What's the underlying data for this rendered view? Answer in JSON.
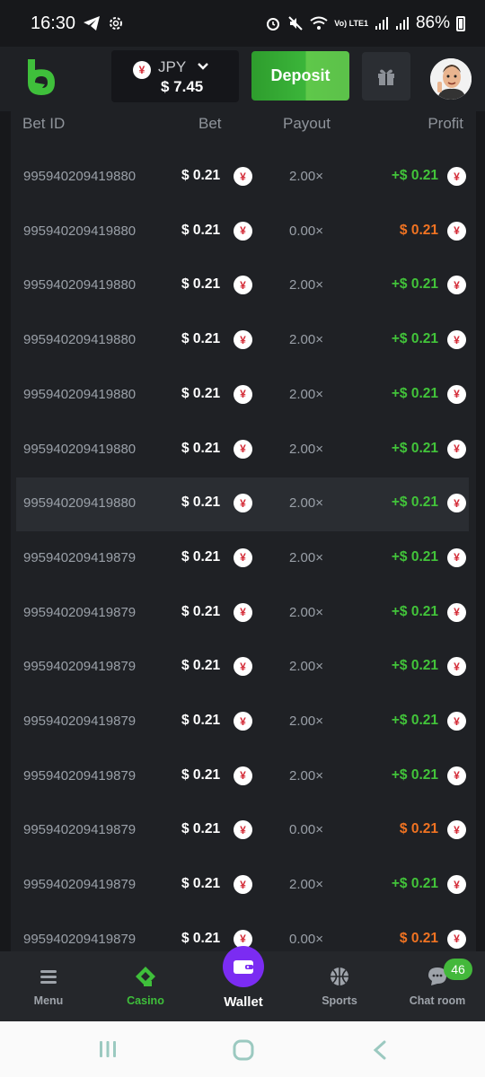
{
  "status_bar": {
    "time": "16:30",
    "network_label": "Vo) LTE1",
    "battery_percent": "86%"
  },
  "header": {
    "currency_symbol": "¥",
    "currency": "JPY",
    "balance": "$ 7.45",
    "deposit_label": "Deposit"
  },
  "table": {
    "columns": [
      "Bet ID",
      "Bet",
      "Payout",
      "Profit"
    ],
    "coin_symbol": "¥",
    "rows": [
      {
        "bet_id": "995940209419880",
        "bet": "$ 0.21",
        "payout": "2.00×",
        "profit": "+$ 0.21",
        "result": "win"
      },
      {
        "bet_id": "995940209419880",
        "bet": "$ 0.21",
        "payout": "0.00×",
        "profit": "$ 0.21",
        "result": "loss"
      },
      {
        "bet_id": "995940209419880",
        "bet": "$ 0.21",
        "payout": "2.00×",
        "profit": "+$ 0.21",
        "result": "win"
      },
      {
        "bet_id": "995940209419880",
        "bet": "$ 0.21",
        "payout": "2.00×",
        "profit": "+$ 0.21",
        "result": "win"
      },
      {
        "bet_id": "995940209419880",
        "bet": "$ 0.21",
        "payout": "2.00×",
        "profit": "+$ 0.21",
        "result": "win"
      },
      {
        "bet_id": "995940209419880",
        "bet": "$ 0.21",
        "payout": "2.00×",
        "profit": "+$ 0.21",
        "result": "win"
      },
      {
        "bet_id": "995940209419880",
        "bet": "$ 0.21",
        "payout": "2.00×",
        "profit": "+$ 0.21",
        "result": "win",
        "highlighted": true
      },
      {
        "bet_id": "995940209419879",
        "bet": "$ 0.21",
        "payout": "2.00×",
        "profit": "+$ 0.21",
        "result": "win"
      },
      {
        "bet_id": "995940209419879",
        "bet": "$ 0.21",
        "payout": "2.00×",
        "profit": "+$ 0.21",
        "result": "win"
      },
      {
        "bet_id": "995940209419879",
        "bet": "$ 0.21",
        "payout": "2.00×",
        "profit": "+$ 0.21",
        "result": "win"
      },
      {
        "bet_id": "995940209419879",
        "bet": "$ 0.21",
        "payout": "2.00×",
        "profit": "+$ 0.21",
        "result": "win"
      },
      {
        "bet_id": "995940209419879",
        "bet": "$ 0.21",
        "payout": "2.00×",
        "profit": "+$ 0.21",
        "result": "win"
      },
      {
        "bet_id": "995940209419879",
        "bet": "$ 0.21",
        "payout": "0.00×",
        "profit": "$ 0.21",
        "result": "loss"
      },
      {
        "bet_id": "995940209419879",
        "bet": "$ 0.21",
        "payout": "2.00×",
        "profit": "+$ 0.21",
        "result": "win"
      },
      {
        "bet_id": "995940209419879",
        "bet": "$ 0.21",
        "payout": "0.00×",
        "profit": "$ 0.21",
        "result": "loss"
      }
    ]
  },
  "bottom_nav": {
    "menu": "Menu",
    "casino": "Casino",
    "wallet": "Wallet",
    "sports": "Sports",
    "chat": "Chat room",
    "chat_badge": "46",
    "active": "casino"
  },
  "colors": {
    "accent_green": "#42c43a",
    "loss_orange": "#f07322",
    "wallet_purple": "#7b2cf2"
  }
}
